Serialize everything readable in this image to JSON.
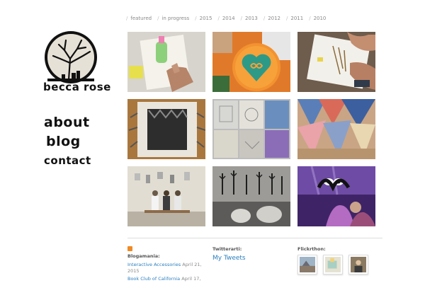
{
  "topnav": {
    "items": [
      {
        "label": "featured"
      },
      {
        "label": "in progress"
      },
      {
        "label": "2015"
      },
      {
        "label": "2014"
      },
      {
        "label": "2013"
      },
      {
        "label": "2012"
      },
      {
        "label": "2011"
      },
      {
        "label": "2010"
      }
    ],
    "separator": "/"
  },
  "brand": {
    "name": "becca rose"
  },
  "sidebar": {
    "items": [
      {
        "label": "about"
      },
      {
        "label": "blog"
      },
      {
        "label": "contact"
      }
    ]
  },
  "gallery": {
    "tiles": [
      {
        "icon": "baby-bottle-print-photo",
        "bg": "#d9d6cf"
      },
      {
        "icon": "heart-infinity-badge-photo",
        "bg": "#f2892a"
      },
      {
        "icon": "drawing-hands-photo",
        "bg": "#8a7b6d"
      },
      {
        "icon": "knitted-square-photo",
        "bg": "#b8864b"
      },
      {
        "icon": "grey-textile-collage-photo",
        "bg": "#c9c9c9"
      },
      {
        "icon": "patchwork-bunting-photo",
        "bg": "#7a8fb3"
      },
      {
        "icon": "people-on-bench-photo",
        "bg": "#dcd6c8"
      },
      {
        "icon": "shadow-puppets-photo",
        "bg": "#6b6a68"
      },
      {
        "icon": "purple-puppet-show-photo",
        "bg": "#3a1f5c"
      }
    ]
  },
  "footer": {
    "blog": {
      "heading": "Blogamania:",
      "posts": [
        {
          "title": "Interactive Accessories",
          "date": "April 21, 2015"
        },
        {
          "title": "Book Club of California",
          "date": "April 17,"
        }
      ]
    },
    "twitter": {
      "heading": "Twitterarti:",
      "link": "My Tweets"
    },
    "flickr": {
      "heading": "Flickrthon:"
    }
  },
  "colors": {
    "link": "#2a7fbf",
    "rss": "#f08a24",
    "nav_text": "#8a8a8a"
  }
}
